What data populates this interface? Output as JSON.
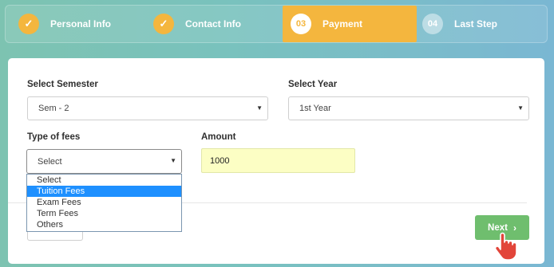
{
  "steps": [
    {
      "marker": "✓",
      "label": "Personal Info",
      "state": "done"
    },
    {
      "marker": "✓",
      "label": "Contact Info",
      "state": "done"
    },
    {
      "marker": "03",
      "label": "Payment",
      "state": "active"
    },
    {
      "marker": "04",
      "label": "Last Step",
      "state": "todo"
    }
  ],
  "form": {
    "semester": {
      "label": "Select Semester",
      "value": "Sem - 2"
    },
    "year": {
      "label": "Select Year",
      "value": "1st Year"
    },
    "fees": {
      "label": "Type of fees",
      "value": "Select",
      "options": [
        "Select",
        "Tuition Fees",
        "Exam Fees",
        "Term Fees",
        "Others"
      ],
      "highlighted": "Tuition Fees"
    },
    "amount": {
      "label": "Amount",
      "value": "1000"
    }
  },
  "next_button": {
    "label": "Next",
    "icon": "chevron-right-icon"
  },
  "icons": {
    "caret": "▼",
    "check": "✓",
    "chevron": "›"
  },
  "colors": {
    "accent": "#f4b63e",
    "next": "#6fbe6e",
    "highlight": "#1e90ff",
    "amount_bg": "#fcfec4"
  }
}
